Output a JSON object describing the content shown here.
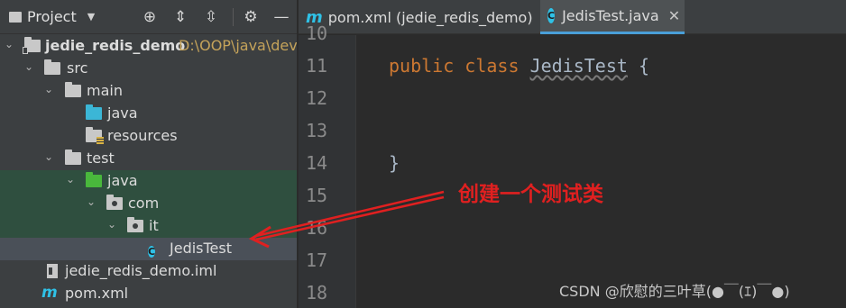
{
  "project_panel": {
    "title": "Project",
    "toolbar_icons": [
      "locate-icon",
      "expand-all-icon",
      "collapse-all-icon",
      "gear-icon",
      "minimize-icon"
    ],
    "tree": [
      {
        "label": "jedie_redis_demo",
        "path": "D:\\OOP\\java\\dev",
        "icon": "project-folder-icon",
        "expanded": true
      },
      {
        "label": "src",
        "icon": "folder-icon",
        "expanded": true
      },
      {
        "label": "main",
        "icon": "folder-icon",
        "expanded": true
      },
      {
        "label": "java",
        "icon": "source-folder-icon"
      },
      {
        "label": "resources",
        "icon": "resources-folder-icon"
      },
      {
        "label": "test",
        "icon": "folder-icon",
        "expanded": true
      },
      {
        "label": "java",
        "icon": "test-source-folder-icon",
        "expanded": true
      },
      {
        "label": "com",
        "icon": "package-icon",
        "expanded": true
      },
      {
        "label": "it",
        "icon": "package-icon",
        "expanded": true
      },
      {
        "label": "JedisTest",
        "icon": "class-icon",
        "selected": true
      },
      {
        "label": "jedie_redis_demo.iml",
        "icon": "iml-file-icon"
      },
      {
        "label": "pom.xml",
        "icon": "maven-icon"
      }
    ]
  },
  "editor": {
    "tabs": [
      {
        "label": "pom.xml (jedie_redis_demo)",
        "icon": "maven-icon",
        "active": false
      },
      {
        "label": "JedisTest.java",
        "icon": "class-icon",
        "active": true,
        "close": "✕"
      }
    ],
    "line_numbers": [
      "10",
      "11",
      "12",
      "13",
      "14",
      "15",
      "16",
      "17",
      "18"
    ],
    "code": {
      "kw1": "public",
      "kw2": "class",
      "class_name": "JedisTest",
      "open_brace": "{",
      "close_brace": "}"
    }
  },
  "annotation": {
    "text": "创建一个测试类",
    "color": "#e02020"
  },
  "watermark": "CSDN @欣慰的三叶草(●￣(ｴ)￣●)",
  "colors": {
    "panel_bg": "#3c3f41",
    "editor_bg": "#2b2b2b",
    "test_highlight": "#2f4f3f",
    "selection": "#4a5058",
    "keyword": "#cc7832",
    "path": "#c5a35a",
    "class_badge": "#2fc1e6"
  }
}
